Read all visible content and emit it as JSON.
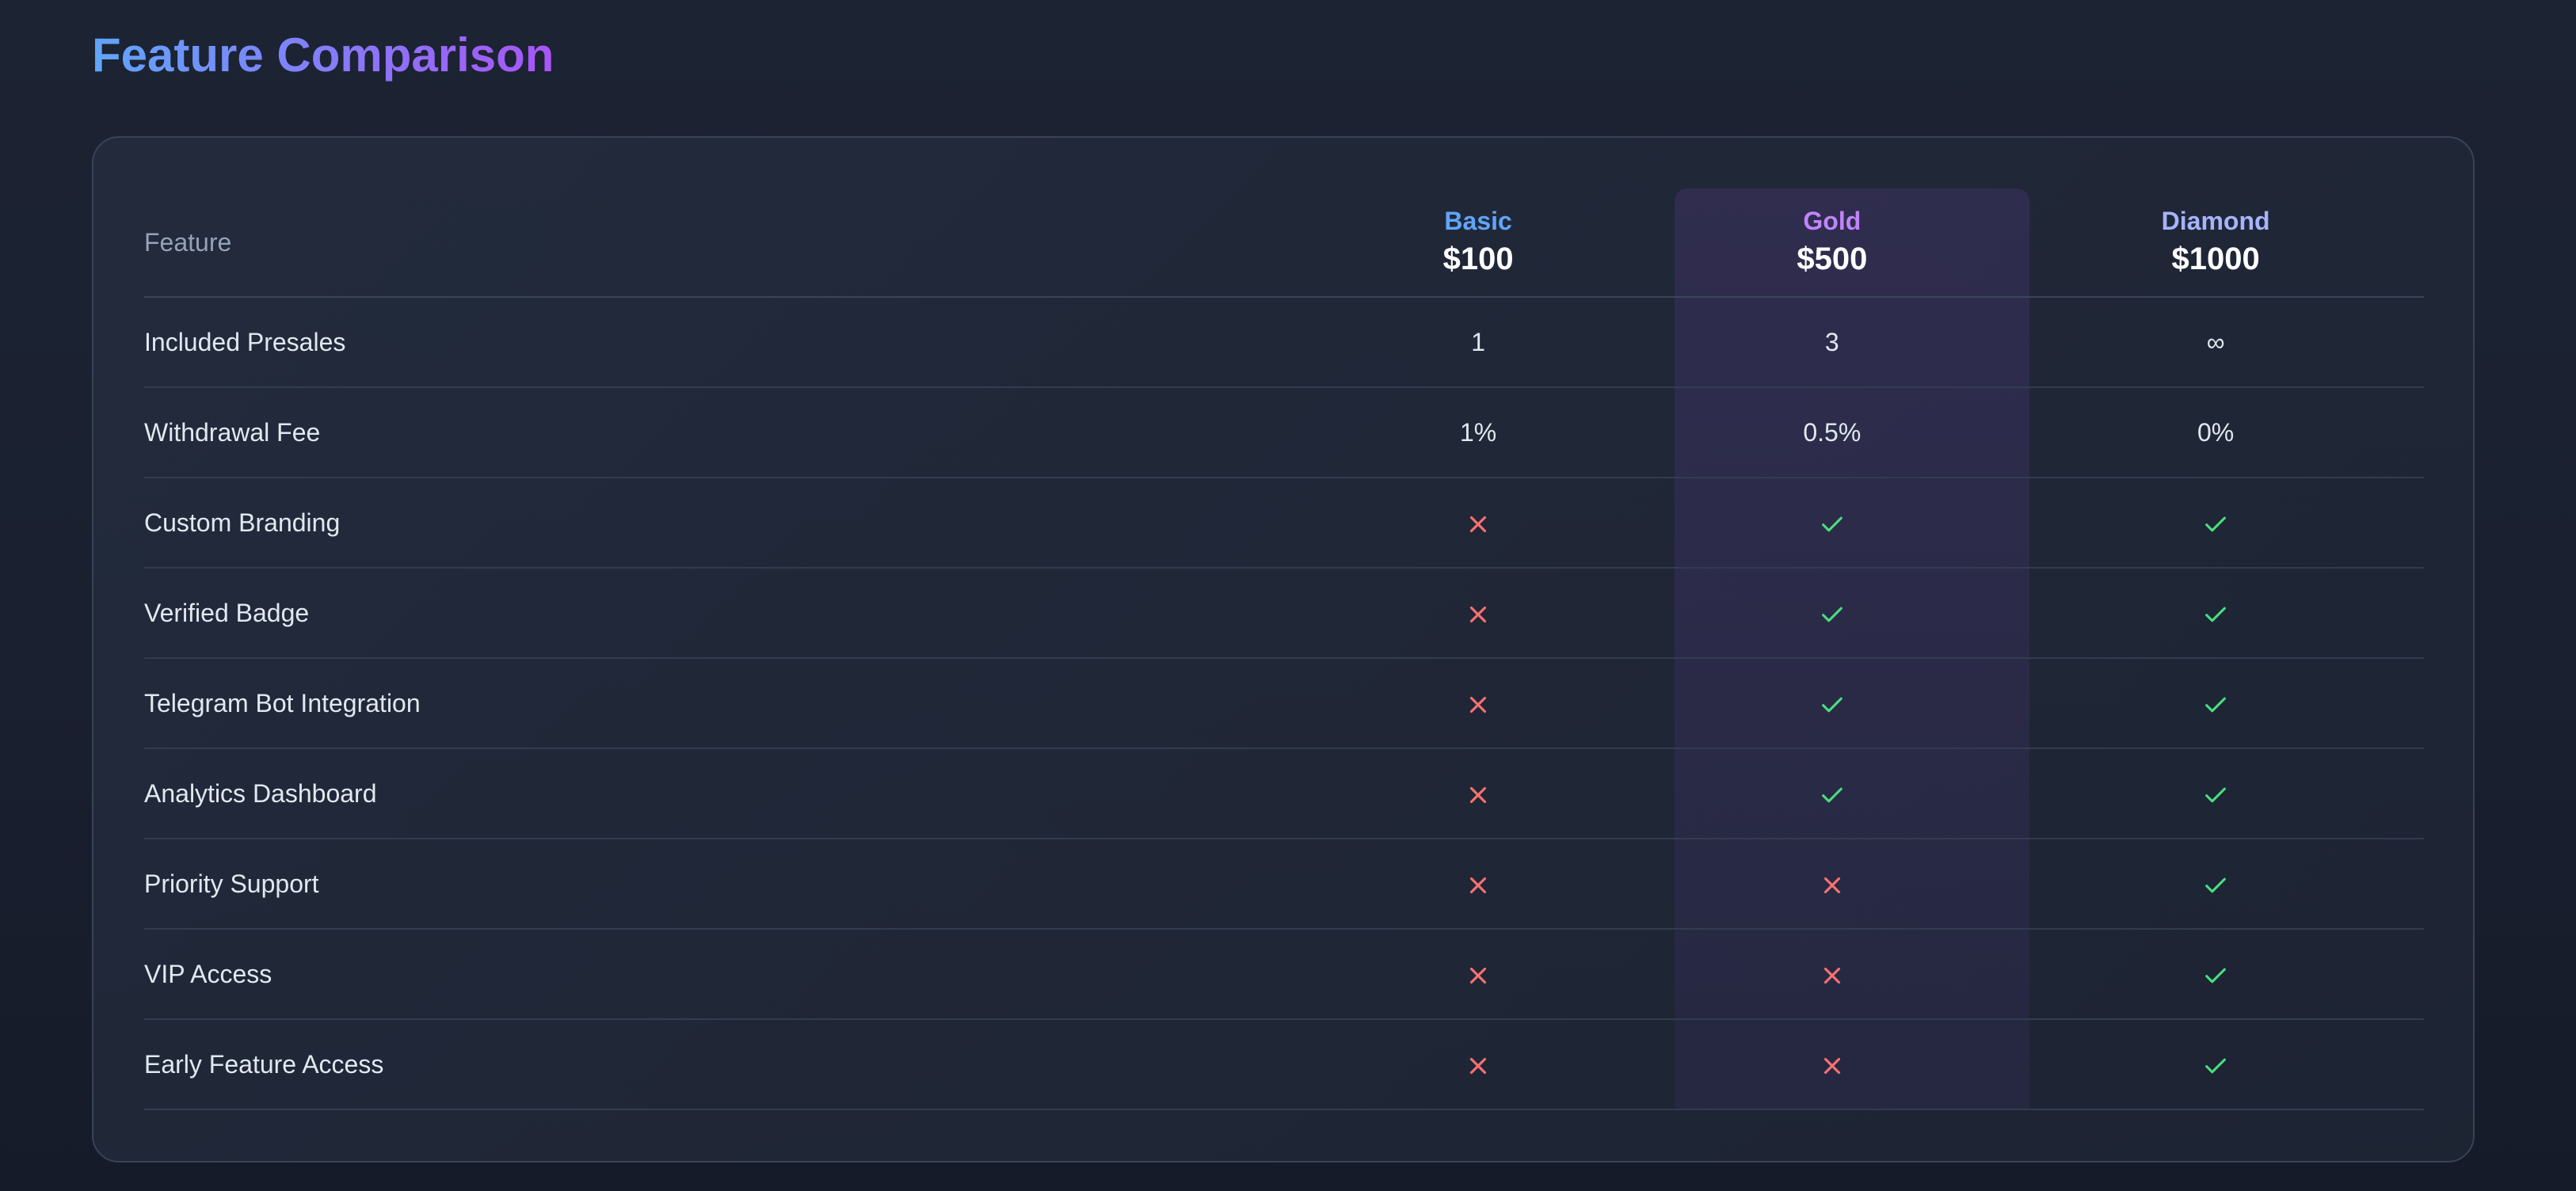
{
  "page": {
    "title": "Feature Comparison"
  },
  "colors": {
    "basic": "#60a5fa",
    "gold": "#c084fc",
    "diamond": "#a5b4fc",
    "check": "#4ade80",
    "cross": "#f87171"
  },
  "table": {
    "header": {
      "feature_label": "Feature",
      "tiers": [
        {
          "name": "Basic",
          "price": "$100"
        },
        {
          "name": "Gold",
          "price": "$500"
        },
        {
          "name": "Diamond",
          "price": "$1000"
        }
      ]
    },
    "rows": [
      {
        "feature": "Included Presales",
        "values": [
          "1",
          "3",
          "∞"
        ]
      },
      {
        "feature": "Withdrawal Fee",
        "values": [
          "1%",
          "0.5%",
          "0%"
        ]
      },
      {
        "feature": "Custom Branding",
        "values": [
          "cross-icon",
          "check-icon",
          "check-icon"
        ]
      },
      {
        "feature": "Verified Badge",
        "values": [
          "cross-icon",
          "check-icon",
          "check-icon"
        ]
      },
      {
        "feature": "Telegram Bot Integration",
        "values": [
          "cross-icon",
          "check-icon",
          "check-icon"
        ]
      },
      {
        "feature": "Analytics Dashboard",
        "values": [
          "cross-icon",
          "check-icon",
          "check-icon"
        ]
      },
      {
        "feature": "Priority Support",
        "values": [
          "cross-icon",
          "cross-icon",
          "check-icon"
        ]
      },
      {
        "feature": "VIP Access",
        "values": [
          "cross-icon",
          "cross-icon",
          "check-icon"
        ]
      },
      {
        "feature": "Early Feature Access",
        "values": [
          "cross-icon",
          "cross-icon",
          "check-icon"
        ]
      }
    ]
  }
}
